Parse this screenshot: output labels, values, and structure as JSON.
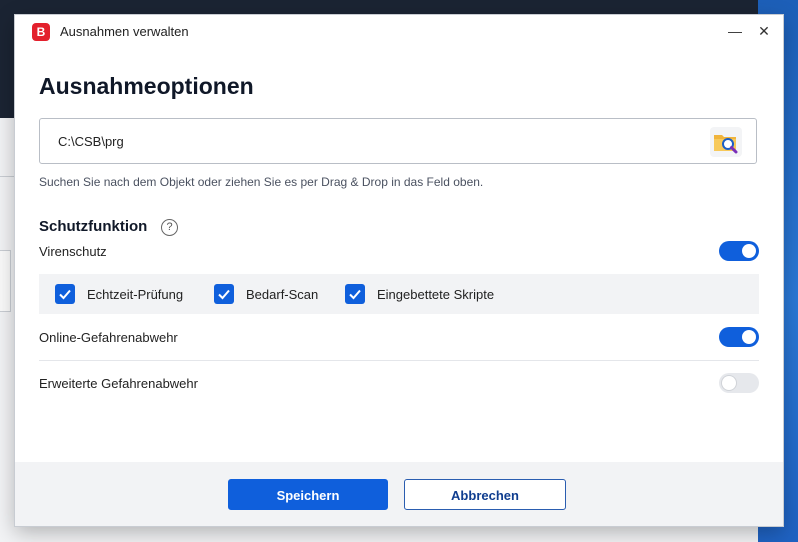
{
  "window": {
    "title": "Ausnahmen verwalten",
    "logo_letter": "B",
    "minimize_glyph": "—",
    "close_glyph": "✕"
  },
  "heading": "Ausnahmeoptionen",
  "path_field": {
    "value": "C:\\CSB\\prg",
    "browse_icon": "folder-search-icon"
  },
  "hint": "Suchen Sie nach dem Objekt oder ziehen Sie es per Drag & Drop in das Feld oben.",
  "protection": {
    "title": "Schutzfunktion",
    "help_glyph": "?",
    "virus": {
      "label": "Virenschutz",
      "enabled": true,
      "options": [
        {
          "label": "Echtzeit-Prüfung",
          "checked": true
        },
        {
          "label": "Bedarf-Scan",
          "checked": true
        },
        {
          "label": "Eingebettete Skripte",
          "checked": true
        }
      ]
    },
    "online": {
      "label": "Online-Gefahrenabwehr",
      "enabled": true
    },
    "advanced": {
      "label": "Erweiterte Gefahrenabwehr",
      "enabled": false
    }
  },
  "footer": {
    "save_label": "Speichern",
    "cancel_label": "Abbrechen"
  },
  "colors": {
    "accent": "#0f5fdc",
    "brand": "#e3202c"
  }
}
